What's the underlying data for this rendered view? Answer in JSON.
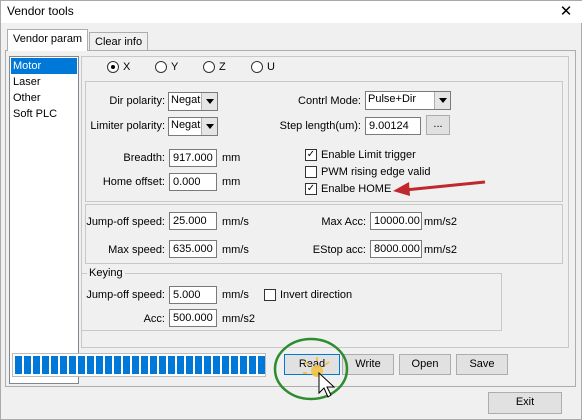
{
  "window": {
    "title": "Vendor tools",
    "close_glyph": "✕"
  },
  "tabs": [
    {
      "label": "Vendor param",
      "active": true
    },
    {
      "label": "Clear info",
      "active": false
    }
  ],
  "sidebar": {
    "items": [
      {
        "label": "Motor",
        "selected": true
      },
      {
        "label": "Laser",
        "selected": false
      },
      {
        "label": "Other",
        "selected": false
      },
      {
        "label": "Soft PLC",
        "selected": false
      }
    ]
  },
  "axes": {
    "options": [
      "X",
      "Y",
      "Z",
      "U"
    ],
    "selected": "X"
  },
  "motor": {
    "dir_polarity": {
      "label": "Dir polarity:",
      "value": "Negat"
    },
    "limiter_polarity": {
      "label": "Limiter polarity:",
      "value": "Negat"
    },
    "contrl_mode": {
      "label": "Contrl Mode:",
      "value": "Pulse+Dir"
    },
    "step_length": {
      "label": "Step length(um):",
      "value": "9.00124",
      "browse_label": "..."
    },
    "breadth": {
      "label": "Breadth:",
      "value": "917.000",
      "unit": "mm"
    },
    "home_offset": {
      "label": "Home offset:",
      "value": "0.000",
      "unit": "mm"
    },
    "enable_limit_trigger": {
      "label": "Enable Limit trigger",
      "checked": true
    },
    "pwm_rising_edge": {
      "label": "PWM rising edge valid",
      "checked": false
    },
    "enable_home": {
      "label": "Enalbe HOME",
      "checked": true
    }
  },
  "speed": {
    "jumpoff_speed": {
      "label": "Jump-off speed:",
      "value": "25.000",
      "unit": "mm/s"
    },
    "max_speed": {
      "label": "Max speed:",
      "value": "635.000",
      "unit": "mm/s"
    },
    "max_acc": {
      "label": "Max Acc:",
      "value": "10000.00",
      "unit": "mm/s2"
    },
    "estop_acc": {
      "label": "EStop acc:",
      "value": "8000.000",
      "unit": "mm/s2"
    }
  },
  "keying": {
    "title": "Keying",
    "jumpoff_speed": {
      "label": "Jump-off speed:",
      "value": "5.000",
      "unit": "mm/s"
    },
    "acc": {
      "label": "Acc:",
      "value": "500.000",
      "unit": "mm/s2"
    },
    "invert_direction": {
      "label": "Invert direction",
      "checked": false
    }
  },
  "progress": {
    "value": 1.0,
    "color": "#0078d7"
  },
  "actions": {
    "read_label": "Read",
    "write_label": "Write",
    "open_label": "Open",
    "save_label": "Save",
    "exit_label": "Exit"
  },
  "annotations": {
    "arrow_color": "#c0282d",
    "circle_color": "#2e8b2e"
  }
}
